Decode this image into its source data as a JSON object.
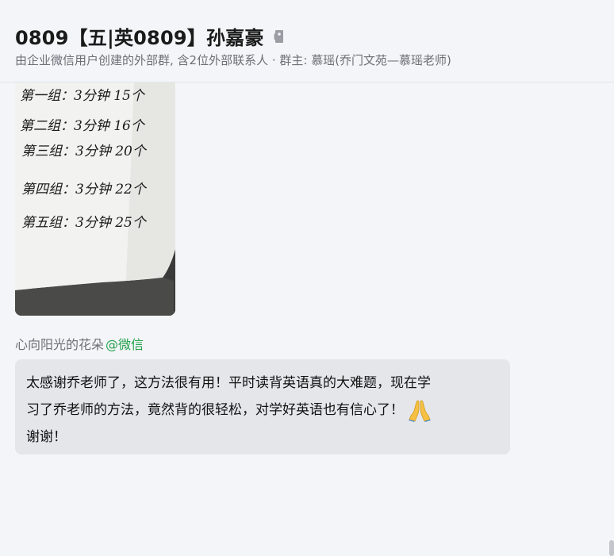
{
  "header": {
    "title": "0809【五|英0809】孙嘉豪",
    "subtitle": "由企业微信用户创建的外部群, 含2位外部联系人 · 群主: 慕瑶(乔门文苑—慕瑶老师)"
  },
  "photo": {
    "lines": [
      "第一组：3分钟 15个",
      "第二组：3分钟 16个",
      "第三组：3分钟 20个",
      "第四组：3分钟 22个",
      "第五组：3分钟 25个"
    ]
  },
  "message": {
    "sender_name": "心向阳光的花朵",
    "sender_source": "@微信",
    "line1": "太感谢乔老师了，这方法很有用！平时读背英语真的大难题，现在学",
    "line2": "习了乔老师的方法，竟然背的很轻松，对学好英语也有信心了！",
    "line3": "谢谢！",
    "emoji": "pray-emoji"
  },
  "colors": {
    "background": "#f4f5f8",
    "bubble": "#e4e6ea",
    "wechat_green": "#23a14b"
  }
}
